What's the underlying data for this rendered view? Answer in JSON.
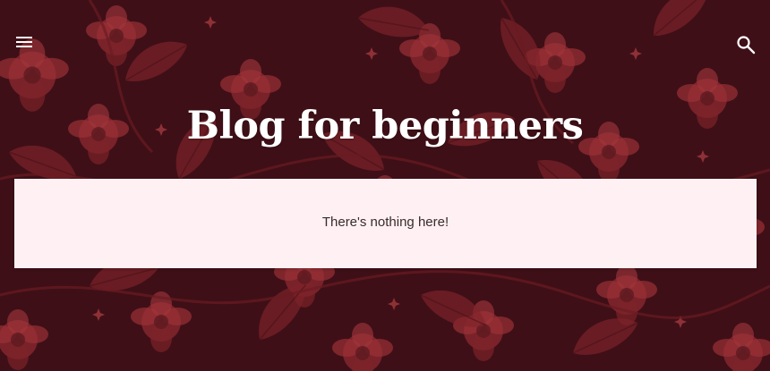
{
  "header": {
    "title": "Blog for beginners",
    "menu_icon": "menu-icon",
    "search_icon": "search-icon"
  },
  "main": {
    "empty_message": "There's nothing here!"
  },
  "colors": {
    "background": "#3f0f17",
    "pattern": "#8e2a30",
    "card": "#fff1f3",
    "title": "#ffffff"
  }
}
